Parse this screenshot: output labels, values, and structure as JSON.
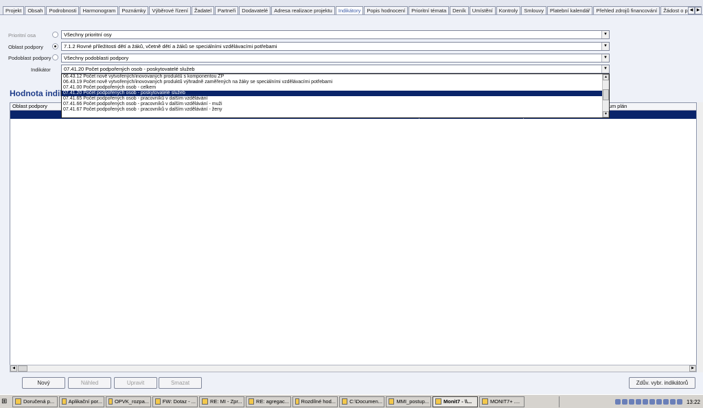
{
  "tabs": [
    "Projekt",
    "Obsah",
    "Podrobnosti",
    "Harmonogram",
    "Poznámky",
    "Výběrové řízení",
    "Žadatel",
    "Partneři",
    "Dodavatelé",
    "Adresa realizace projektu",
    "Indikátory",
    "Popis hodnocení",
    "Prioritní témata",
    "Deník",
    "Umístění",
    "Kontroly",
    "Smlouvy",
    "Platební kalendář",
    "Přehled zdrojů financování",
    "Žádost o platbu"
  ],
  "active_tab": "Indikátory",
  "filters": {
    "prioritni_osa": {
      "label": "Prioritní osa",
      "value": "Všechny prioritní osy"
    },
    "oblast_podpory": {
      "label": "Oblast podpory",
      "value": "7.1.2 Rovné příležitosti dětí a žáků, včetně dětí a žáků se speciálními vzdělávacími potřebami"
    },
    "podoblast_podpory": {
      "label": "Podoblast podpory",
      "value": "Všechny podoblasti podpory"
    },
    "indikator": {
      "label": "Indikátor",
      "value": "07.41.20 Počet podpořených osob - poskytovatelé služeb"
    }
  },
  "dropdown_items": [
    "06.43.12 Počet nově vytvořených/inovovaných produktů s komponentou ŽP",
    "06.43.19 Počet nově vytvořených/inovovaných produktů výhradně zaměřených na žáky se speciálními vzdělávacími potřebami",
    "07.41.00 Počet podpořených osob - celkem",
    "07.41.20 Počet podpořených osob - poskytovatelé služeb",
    "07.41.65 Počet podpořených osob - pracovníků v dalším vzdělávání",
    "07.41.66 Počet podpořených osob - pracovníků v dalším vzdělávání - muži",
    "07.41.67 Počet podpořených osob - pracovníků v dalším vzdělávání - ženy"
  ],
  "dropdown_selected_index": 3,
  "section_title": "Hodnota indikátorů",
  "grid": {
    "col_first": "Oblast podpory",
    "col_last": "Datum plán"
  },
  "buttons": {
    "new": "Nový",
    "preview": "Náhled",
    "edit": "Upravit",
    "delete": "Smazat",
    "summary": "Zdův. vybr. indikátorů"
  },
  "taskbar": {
    "items": [
      "Doručená p...",
      "Aplikační por...",
      "OPVK_rozpa...",
      "FW: Dotaz - ...",
      "RE: MI - Zpr...",
      "RE: agregac...",
      "Rozdílné hod...",
      "C:\\Documen...",
      "MMI_postup...",
      "Monit7 - \\\\...",
      "MONIT7+ ...."
    ],
    "active_index": 9,
    "clock": "13:22"
  }
}
